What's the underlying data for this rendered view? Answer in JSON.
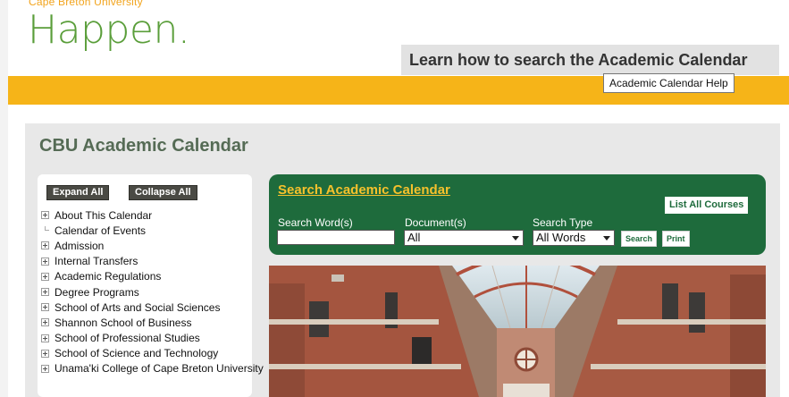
{
  "brand": {
    "university": "Cape Breton University",
    "tagline": "Happen."
  },
  "header": {
    "learn_link": "Learn how to search the Academic Calendar",
    "help_button": "Academic Calendar Help"
  },
  "calendar": {
    "title": "CBU Academic Calendar"
  },
  "toc": {
    "expand_all": "Expand All",
    "collapse_all": "Collapse All",
    "items": [
      {
        "label": "About This Calendar",
        "expandable": true
      },
      {
        "label": "Calendar of Events",
        "expandable": false
      },
      {
        "label": "Admission",
        "expandable": true
      },
      {
        "label": "Internal Transfers",
        "expandable": true
      },
      {
        "label": "Academic Regulations",
        "expandable": true
      },
      {
        "label": "Degree Programs",
        "expandable": true
      },
      {
        "label": "School of Arts and Social Sciences",
        "expandable": true
      },
      {
        "label": "Shannon School of Business",
        "expandable": true
      },
      {
        "label": "School of Professional Studies",
        "expandable": true
      },
      {
        "label": "School of Science and Technology",
        "expandable": true
      },
      {
        "label": "Unama'ki College of Cape Breton University",
        "expandable": true
      }
    ]
  },
  "search": {
    "title": "Search Academic Calendar",
    "list_all_courses": "List All Courses",
    "word_label": "Search Word(s)",
    "word_value": "",
    "document_label": "Document(s)",
    "document_value": "All",
    "type_label": "Search Type",
    "type_value": "All Words",
    "search_button": "Search",
    "print_button": "Print"
  },
  "colors": {
    "gold": "#f6b418",
    "green_dark": "#1e6b3c",
    "brand_green": "#5a9e3a",
    "title_green": "#556b55"
  }
}
